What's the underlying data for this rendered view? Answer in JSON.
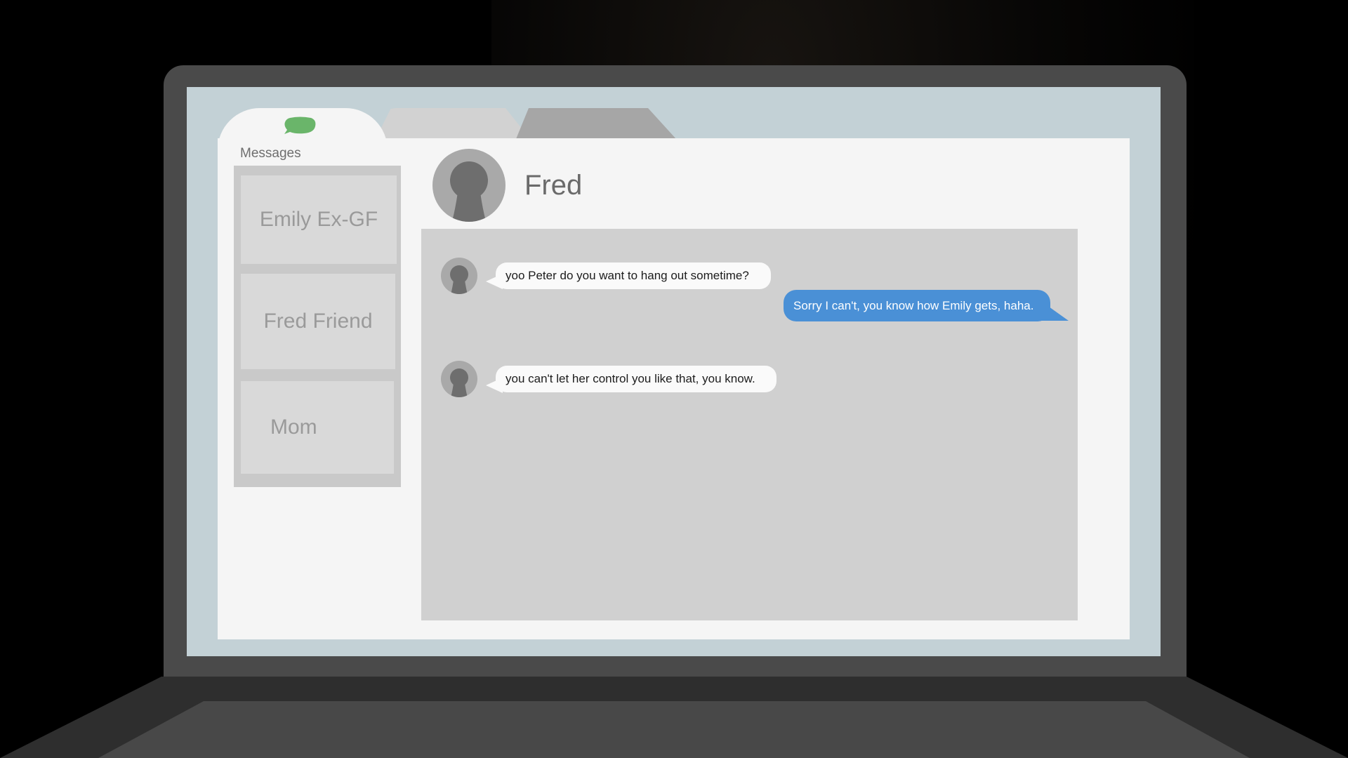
{
  "app": {
    "section_label": "Messages",
    "colors": {
      "accent_green": "#6ab56a",
      "outgoing_blue": "#4a90d6",
      "screen_frame": "#c3d1d6"
    },
    "tab_icon": "speech-bubble-icon"
  },
  "contacts": [
    {
      "label": "Emily Ex-GF"
    },
    {
      "label": "Fred Friend"
    },
    {
      "label": "Mom"
    }
  ],
  "conversation": {
    "contact_name": "Fred",
    "messages": [
      {
        "direction": "incoming",
        "text": "yoo Peter do you want to hang out sometime?"
      },
      {
        "direction": "outgoing",
        "text": "Sorry I can't, you know how Emily gets, haha."
      },
      {
        "direction": "incoming",
        "text": "you can't let her control you like that, you know."
      }
    ]
  }
}
